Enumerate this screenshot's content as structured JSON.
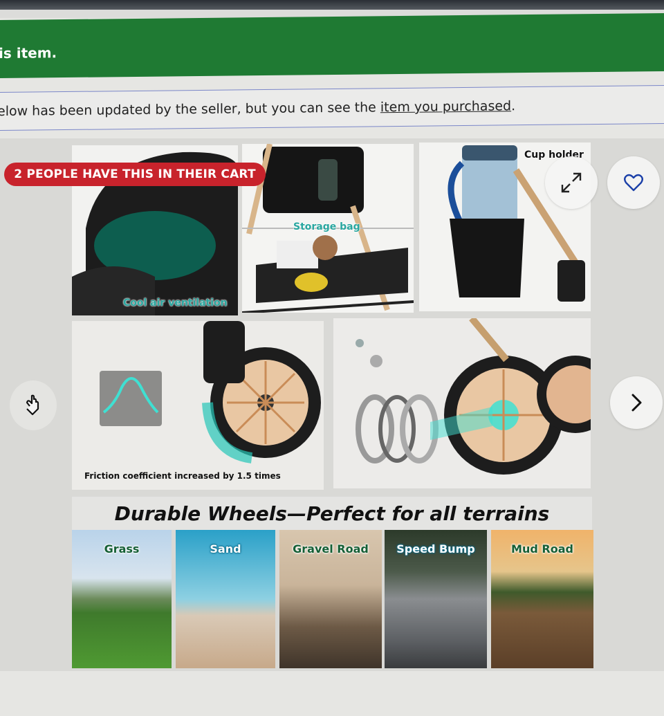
{
  "banner": {
    "text": "is item."
  },
  "notice": {
    "prefix": "elow has been updated by the seller, but you can see the ",
    "link": "item you purchased",
    "suffix": "."
  },
  "gallery": {
    "cart_badge": "2 PEOPLE HAVE THIS IN THEIR CART",
    "labels": {
      "cool_air": "Cool air ventilation",
      "storage": "Storage bag",
      "cup_holder": "Cup holder",
      "friction": "Friction coefficient increased by 1.5 times"
    },
    "heading": "Durable Wheels—Perfect for all terrains",
    "terrains": [
      "Grass",
      "Sand",
      "Gravel Road",
      "Speed Bump",
      "Mud Road"
    ]
  },
  "colors": {
    "banner_green": "#1f7a33",
    "badge_red": "#c8232c",
    "accent_teal": "#2aa7a0",
    "heart_blue": "#1a3fa8"
  },
  "icons": {
    "expand": "expand-icon",
    "favorite": "heart-icon",
    "next": "chevron-right-icon",
    "cursor": "hand-pointer-icon"
  }
}
